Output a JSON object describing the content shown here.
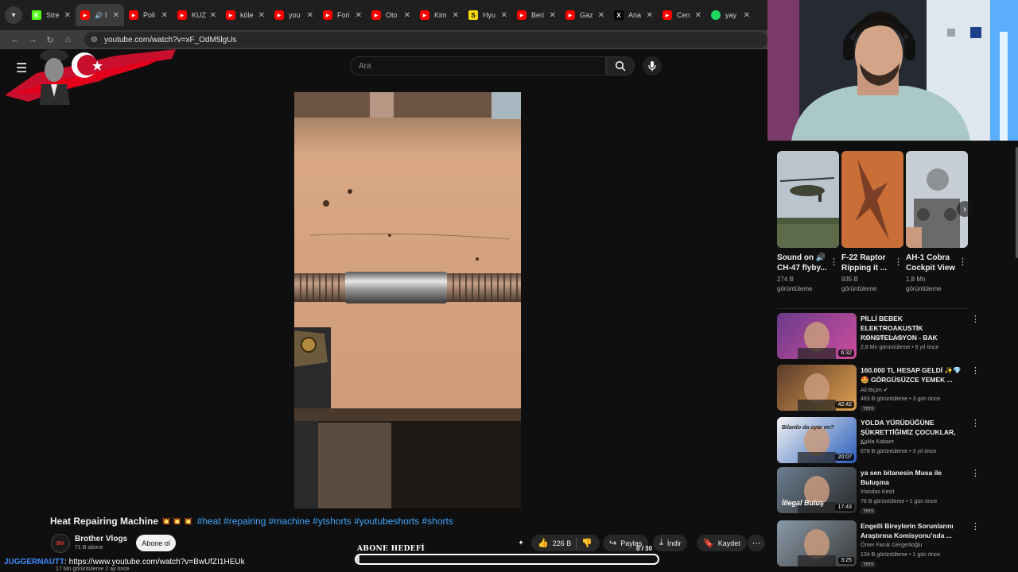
{
  "browser": {
    "tabs": [
      {
        "label": "Stre",
        "favicon": "K",
        "color": "#53fc18"
      },
      {
        "label": "I",
        "favicon": "yt-icon",
        "color": "#ff0000",
        "active": true,
        "audio": true
      },
      {
        "label": "Poli",
        "favicon": "yt-icon",
        "color": "#ff0000"
      },
      {
        "label": "KUZ",
        "favicon": "yt-icon",
        "color": "#ff0000"
      },
      {
        "label": "köle",
        "favicon": "yt-icon",
        "color": "#ff0000"
      },
      {
        "label": "you",
        "favicon": "yt-icon",
        "color": "#ff0000"
      },
      {
        "label": "Fori",
        "favicon": "yt-icon",
        "color": "#ff0000"
      },
      {
        "label": "Oto",
        "favicon": "yt-icon",
        "color": "#ff0000"
      },
      {
        "label": "Kim",
        "favicon": "yt-icon",
        "color": "#ff0000"
      },
      {
        "label": "Hyu",
        "favicon": "S",
        "color": "#f5d90a"
      },
      {
        "label": "Beri",
        "favicon": "yt-icon",
        "color": "#ff0000"
      },
      {
        "label": "Gaz",
        "favicon": "yt-icon",
        "color": "#ff0000"
      },
      {
        "label": "Ana",
        "favicon": "X",
        "color": "#000000"
      },
      {
        "label": "Cen",
        "favicon": "yt-icon",
        "color": "#ff0000"
      },
      {
        "label": "yay",
        "favicon": "spotify-icon",
        "color": "#1ed760"
      }
    ],
    "url": "youtube.com/watch?v=xF_OdM5lgUs"
  },
  "youtube": {
    "search_placeholder": "Ara",
    "video": {
      "title": "Heat Repairing Machine",
      "sparkles": "💥 💥 💥",
      "hashtags": "#heat #repairing #machine #ytshorts #youtubeshorts #shorts",
      "views_line": "17 Mn görüntüleme  2 ay önce"
    },
    "channel": {
      "name": "Brother Vlogs",
      "subs": "71 B abone",
      "avatar_text": "BV",
      "subscribe_label": "Abone ol"
    },
    "actions": {
      "likes": "226 B",
      "share": "Paylaş",
      "download": "İndir",
      "save": "Kaydet"
    }
  },
  "overlay": {
    "goal_label": "ABONE HEDEFİ",
    "goal_current": "0",
    "goal_total": "/ 30",
    "goal_progress": 0.01,
    "chat_user": "JUGGERNAUTT",
    "chat_text": ": https://www.youtube.com/watch?v=BwUfZI1HEUk"
  },
  "sidebar": {
    "shorts": [
      {
        "title": "Sound on 🔊 CH-47 flyby...",
        "views": "274 B görüntüleme"
      },
      {
        "title": "F-22 Raptor Ripping it ...",
        "views": "935 B görüntüleme"
      },
      {
        "title": "AH-1 Cobra Cockpit View",
        "views": "1,8 Mn görüntüleme"
      }
    ],
    "recommendations": [
      {
        "title": "PİLLİ BEBEK ELEKTROAKUSTİK KONSTELASYON - BAK",
        "channel": "Aşk Müzik Yapım",
        "meta": "2,8 Mn görüntüleme • 6 yıl önce",
        "duration": "6:32",
        "badge": ""
      },
      {
        "title": "160.000 TL HESAP GELDİ ✨💎🤩 GÖRGÜSÜZCE YEMEK ...",
        "channel": "Ali Biçim ✔",
        "meta": "483 B görüntüleme • 3 gün önce",
        "duration": "42:42",
        "badge": "Yeni"
      },
      {
        "title": "YOLDA YÜRÜDÜĞÜNE ŞÜKRETTİĞİMİZ ÇOCUKLAR, ...",
        "channel": "Kukla Kabare",
        "meta": "678 B görüntüleme • 3 yıl önce",
        "duration": "20:07",
        "badge": "",
        "thumb_caption": "Bilardo da oyar mı?"
      },
      {
        "title": "ya sen bitanesin Musa ile Buluşma",
        "channel": "İrlandas Kesit",
        "meta": "76 B görüntüleme • 1 gün önce",
        "duration": "17:43",
        "badge": "Yeni",
        "thumb_caption": "İllegal Buluş"
      },
      {
        "title": "Engelli Bireylerin Sorunlarını Araştırma Komisyonu'nda ...",
        "channel": "Ömer Faruk Gergerlioğlu",
        "meta": "134 B görüntüleme • 1 gün önce",
        "duration": "3:25",
        "badge": "Yeni"
      }
    ]
  }
}
